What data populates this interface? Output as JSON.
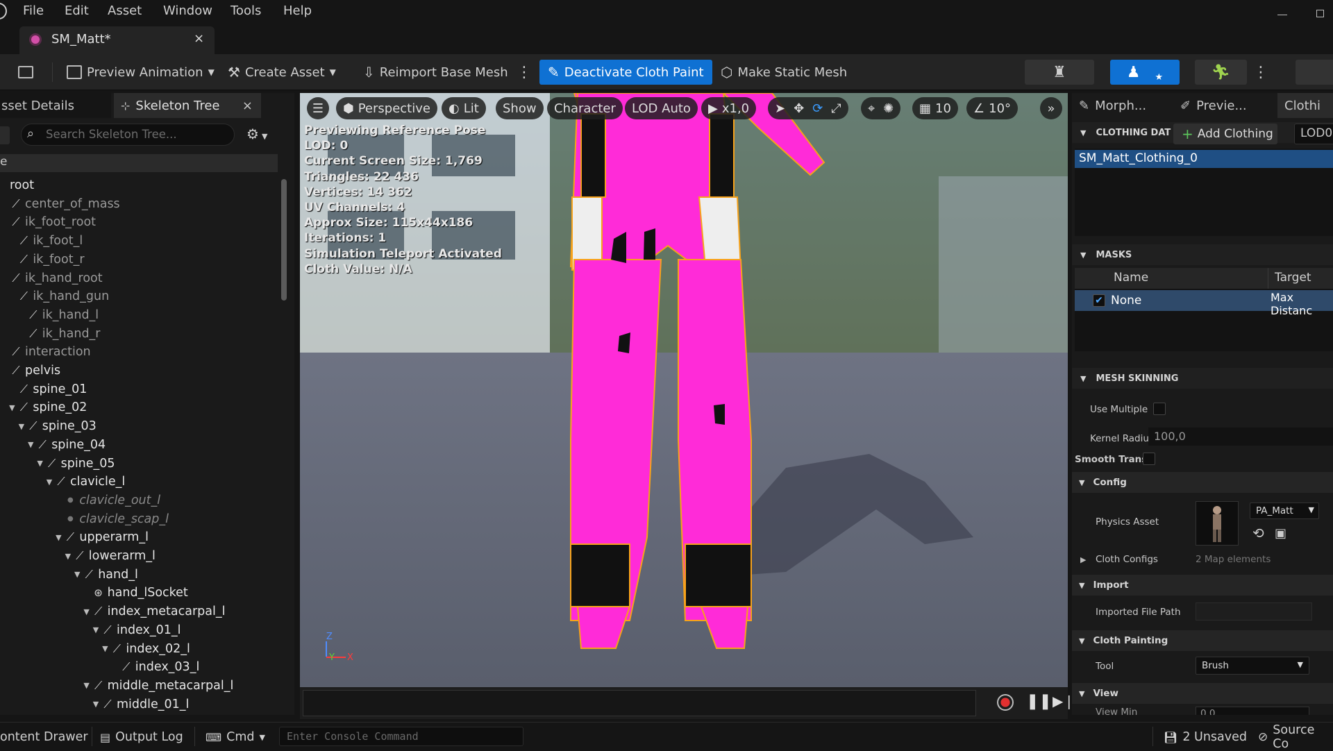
{
  "menu": [
    "File",
    "Edit",
    "Asset",
    "Window",
    "Tools",
    "Help"
  ],
  "tab": {
    "title": "SM_Matt*"
  },
  "toolbar": {
    "preview_animation": "Preview Animation",
    "create_asset": "Create Asset",
    "reimport": "Reimport Base Mesh",
    "deactivate_cloth": "Deactivate Cloth Paint",
    "make_static": "Make Static Mesh"
  },
  "left": {
    "tab_asset_details": "sset Details",
    "tab_skeleton_tree": "Skeleton Tree",
    "search_placeholder": "Search Skeleton Tree...",
    "col_header": "e",
    "tree": [
      {
        "label": "root",
        "indent": 0,
        "kind": "plain",
        "style": "bright"
      },
      {
        "label": "center_of_mass",
        "indent": 0,
        "kind": "bone",
        "style": "dim"
      },
      {
        "label": "ik_foot_root",
        "indent": 0,
        "kind": "bone",
        "style": "dim"
      },
      {
        "label": "ik_foot_l",
        "indent": 1,
        "kind": "bone",
        "style": "dim"
      },
      {
        "label": "ik_foot_r",
        "indent": 1,
        "kind": "bone",
        "style": "dim"
      },
      {
        "label": "ik_hand_root",
        "indent": 0,
        "kind": "bone",
        "style": "dim"
      },
      {
        "label": "ik_hand_gun",
        "indent": 1,
        "kind": "bone",
        "style": "dim"
      },
      {
        "label": "ik_hand_l",
        "indent": 2,
        "kind": "bone",
        "style": "dim"
      },
      {
        "label": "ik_hand_r",
        "indent": 2,
        "kind": "bone",
        "style": "dim"
      },
      {
        "label": "interaction",
        "indent": 0,
        "kind": "bone",
        "style": "dim"
      },
      {
        "label": "pelvis",
        "indent": 0,
        "kind": "bone",
        "style": "bright"
      },
      {
        "label": "spine_01",
        "indent": 1,
        "kind": "bone",
        "style": "bright"
      },
      {
        "label": "spine_02",
        "indent": 1,
        "kind": "bone",
        "style": "bright",
        "open": true
      },
      {
        "label": "spine_03",
        "indent": 2,
        "kind": "bone",
        "style": "bright",
        "open": true
      },
      {
        "label": "spine_04",
        "indent": 3,
        "kind": "bone",
        "style": "bright",
        "open": true
      },
      {
        "label": "spine_05",
        "indent": 4,
        "kind": "bone",
        "style": "bright",
        "open": true
      },
      {
        "label": "clavicle_l",
        "indent": 5,
        "kind": "bone",
        "style": "bright",
        "open": true
      },
      {
        "label": "clavicle_out_l",
        "indent": 6,
        "kind": "dot",
        "style": "ital"
      },
      {
        "label": "clavicle_scap_l",
        "indent": 6,
        "kind": "dot",
        "style": "ital"
      },
      {
        "label": "upperarm_l",
        "indent": 6,
        "kind": "bone",
        "style": "bright",
        "open": true
      },
      {
        "label": "lowerarm_l",
        "indent": 7,
        "kind": "bone",
        "style": "bright",
        "open": true
      },
      {
        "label": "hand_l",
        "indent": 8,
        "kind": "bone",
        "style": "bright",
        "open": true
      },
      {
        "label": "hand_lSocket",
        "indent": 9,
        "kind": "socket",
        "style": "bright"
      },
      {
        "label": "index_metacarpal_l",
        "indent": 9,
        "kind": "bone",
        "style": "bright",
        "open": true
      },
      {
        "label": "index_01_l",
        "indent": 10,
        "kind": "bone",
        "style": "bright",
        "open": true
      },
      {
        "label": "index_02_l",
        "indent": 11,
        "kind": "bone",
        "style": "bright",
        "open": true
      },
      {
        "label": "index_03_l",
        "indent": 12,
        "kind": "bone",
        "style": "bright"
      },
      {
        "label": "middle_metacarpal_l",
        "indent": 9,
        "kind": "bone",
        "style": "bright",
        "open": true
      },
      {
        "label": "middle_01_l",
        "indent": 10,
        "kind": "bone",
        "style": "bright",
        "open": true
      }
    ]
  },
  "viewport": {
    "menu_icon": "hamburger-icon",
    "perspective": "Perspective",
    "lit": "Lit",
    "show": "Show",
    "character": "Character",
    "lod": "LOD Auto",
    "play_speed": "x1,0",
    "grid_value": "10",
    "angle_value": "10°",
    "info": [
      "Previewing Reference Pose",
      "LOD: 0",
      "Current Screen Size: 1,769",
      "Triangles: 22 436",
      "Vertices: 14 362",
      "UV Channels: 4",
      "Approx Size: 115x44x186",
      "Iterations: 1",
      "Simulation Teleport Activated",
      "Cloth Value: N/A"
    ],
    "axis_z": "Z",
    "axis_y": "Y",
    "axis_x": "X"
  },
  "right": {
    "tab_morph": "Morph...",
    "tab_preview": "Previe...",
    "tab_cloth": "Clothi",
    "clothing_data_header": "CLOTHING DAT",
    "add_clothing": "Add Clothing",
    "lod_value": "LOD0",
    "clothing_item": "SM_Matt_Clothing_0",
    "masks_header": "MASKS",
    "col_name": "Name",
    "col_target": "Target",
    "mask_name": "None",
    "mask_target": "Max Distanc",
    "mesh_skinning_header": "MESH SKINNING",
    "use_multiple": "Use Multiple",
    "kernel_radius": "Kernel Radiu",
    "kernel_value": "100,0",
    "smooth_transit": "Smooth Transit",
    "config_header": "Config",
    "physics_asset": "Physics Asset",
    "physics_value": "PA_Matt",
    "cloth_configs": "Cloth Configs",
    "cloth_configs_value": "2 Map elements",
    "import_header": "Import",
    "imported_file_path": "Imported File Path",
    "cloth_painting_header": "Cloth Painting",
    "tool": "Tool",
    "tool_value": "Brush",
    "view_header": "View",
    "view_min": "View Min",
    "view_min_value": "0,0"
  },
  "status": {
    "content_drawer": "ontent Drawer",
    "output_log": "Output Log",
    "cmd": "Cmd",
    "console_placeholder": "Enter Console Command",
    "unsaved": "2 Unsaved",
    "source_control": "Source Co"
  },
  "colors": {
    "accent": "#0f71d3",
    "cloth": "#ff2bd8",
    "outline": "#f7a21b"
  }
}
